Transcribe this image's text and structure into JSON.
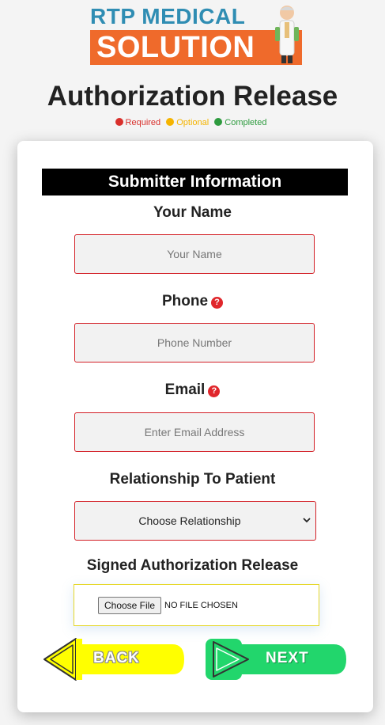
{
  "brand": {
    "line1": "RTP MEDICAL",
    "line2": "SOLUTION"
  },
  "page": {
    "title": "Authorization Release"
  },
  "legend": [
    {
      "label": "Required",
      "color": "#d9302c"
    },
    {
      "label": "Optional",
      "color": "#f5b400"
    },
    {
      "label": "Completed",
      "color": "#2e9b3f"
    }
  ],
  "form": {
    "section_title": "Submitter Information",
    "name": {
      "label": "Your Name",
      "placeholder": "Your Name"
    },
    "phone": {
      "label": "Phone",
      "placeholder": "Phone Number",
      "help_icon": "question-circle-icon"
    },
    "email": {
      "label": "Email",
      "placeholder": "Enter Email Address",
      "help_icon": "question-circle-icon"
    },
    "relationship": {
      "label": "Relationship To Patient",
      "selected": "Choose Relationship"
    },
    "upload": {
      "label": "Signed Authorization Release",
      "button": "Choose File",
      "status": "NO FILE CHOSEN"
    }
  },
  "nav": {
    "back": {
      "label": "BACK",
      "color": "#ffff00"
    },
    "next": {
      "label": "NEXT",
      "color": "#22d66c"
    }
  }
}
